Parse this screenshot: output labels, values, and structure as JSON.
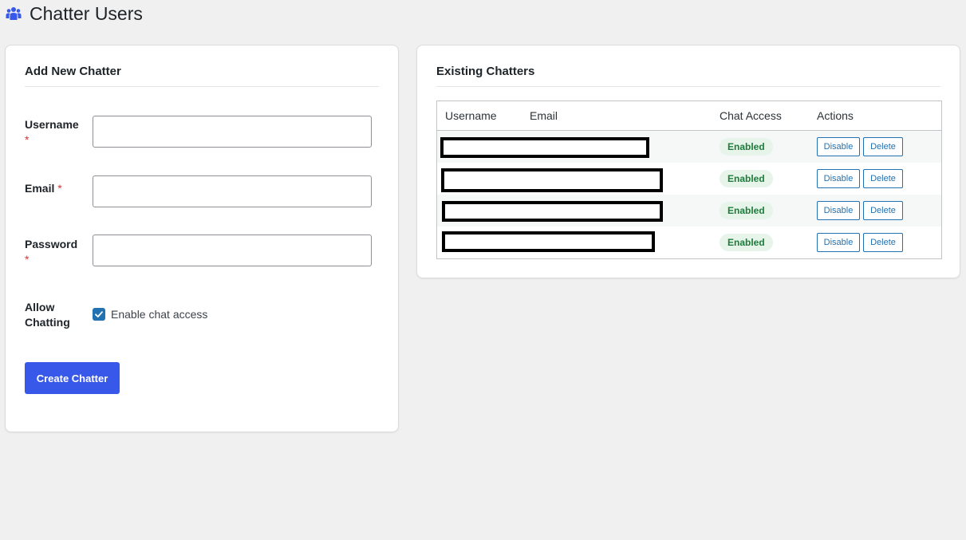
{
  "page": {
    "title": "Chatter Users",
    "icon": "users-group-icon",
    "accent_color": "#3858e9"
  },
  "add_form": {
    "title": "Add New Chatter",
    "username_label": "Username",
    "email_label": "Email",
    "password_label": "Password",
    "required_mark": "*",
    "allow_label_line1": "Allow",
    "allow_label_line2": "Chatting",
    "checkbox_label": "Enable chat access",
    "checkbox_checked": true,
    "username_value": "",
    "email_value": "",
    "password_value": "",
    "submit_label": "Create Chatter"
  },
  "existing": {
    "title": "Existing Chatters",
    "columns": {
      "username": "Username",
      "email": "Email",
      "chat_access": "Chat Access",
      "actions": "Actions"
    },
    "rows": [
      {
        "status": "Enabled",
        "disable_label": "Disable",
        "delete_label": "Delete",
        "redacted": true
      },
      {
        "status": "Enabled",
        "disable_label": "Disable",
        "delete_label": "Delete",
        "redacted": true
      },
      {
        "status": "Enabled",
        "disable_label": "Disable",
        "delete_label": "Delete",
        "redacted": true
      },
      {
        "status": "Enabled",
        "disable_label": "Disable",
        "delete_label": "Delete",
        "redacted": true
      }
    ],
    "status_color": "#1e7c3b",
    "status_bg": "#e6f4ea"
  }
}
